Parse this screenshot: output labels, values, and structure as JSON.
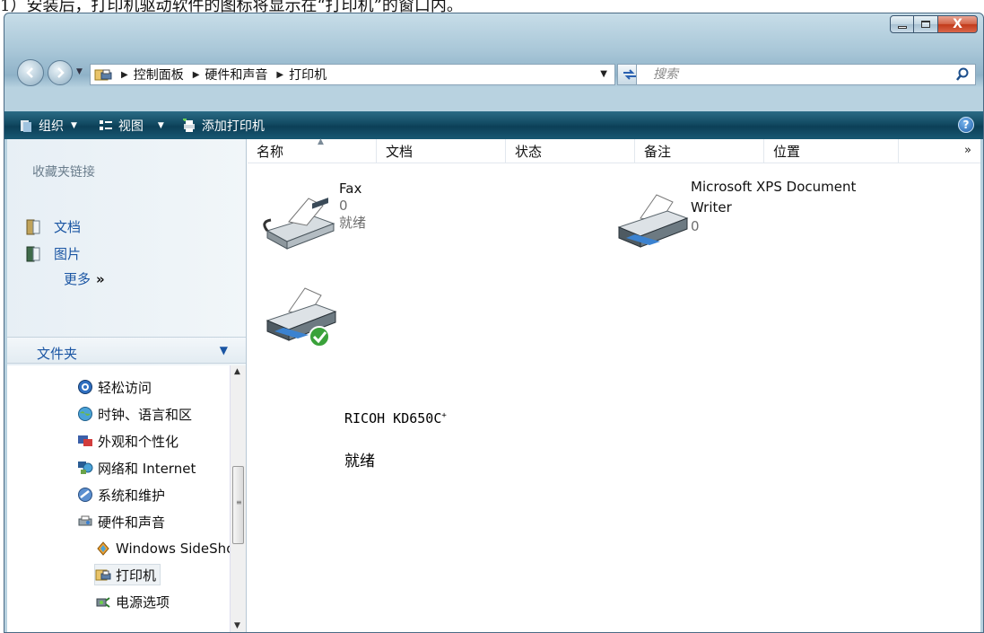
{
  "doc_caption": "1）安装后，打印机驱动软件的图标将显示在“打印机”的窗口内。",
  "window": {
    "caption_buttons": {
      "close": "X"
    }
  },
  "address": {
    "crumbs": [
      "控制面板",
      "硬件和声音",
      "打印机"
    ],
    "search_placeholder": "搜索"
  },
  "commands": {
    "organize": "组织",
    "views": "视图",
    "add_printer": "添加打印机",
    "help": "?"
  },
  "nav": {
    "favorites_title": "收藏夹链接",
    "favorites": [
      {
        "label": "文档",
        "icon": "documents-icon"
      },
      {
        "label": "图片",
        "icon": "pictures-icon"
      }
    ],
    "more_label": "更多",
    "more_chevron": "»",
    "folders_label": "文件夹",
    "tree": [
      {
        "label": "轻松访问",
        "icon": "ease-of-access-icon"
      },
      {
        "label": "时钟、语言和区",
        "icon": "clock-language-globe-icon"
      },
      {
        "label": "外观和个性化",
        "icon": "appearance-icon"
      },
      {
        "label": "网络和 Internet",
        "icon": "network-icon"
      },
      {
        "label": "系统和维护",
        "icon": "system-maintenance-icon"
      },
      {
        "label": "硬件和声音",
        "icon": "hardware-sound-icon"
      },
      {
        "label": "Windows SideShow",
        "icon": "sideshow-icon"
      },
      {
        "label": "打印机",
        "icon": "printer-folder-icon",
        "selected": true
      },
      {
        "label": "电源选项",
        "icon": "power-options-icon"
      }
    ]
  },
  "columns": [
    "名称",
    "文档",
    "状态",
    "备注",
    "位置"
  ],
  "columns_more": "»",
  "printers": [
    {
      "name": "Fax",
      "docs": "0",
      "status": "就绪",
      "icon": "fax-icon"
    },
    {
      "name_line1": "Microsoft XPS Document",
      "name_line2": "Writer",
      "docs": "0",
      "icon": "printer-icon"
    },
    {
      "name": "RICOH KD650C",
      "superscript": "+",
      "status": "就绪",
      "icon": "default-printer-icon"
    }
  ],
  "colors": {
    "cmdbar": "#124a62",
    "link": "#1a55a3",
    "close": "#c23a1a"
  }
}
